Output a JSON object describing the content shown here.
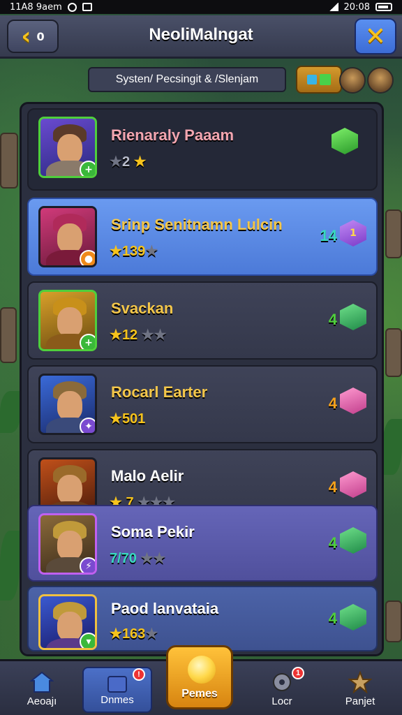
{
  "status_bar": {
    "time_left": "11A8 9aem",
    "time_right": "20:08"
  },
  "header": {
    "back_count": "0",
    "title": "NeoliMalngat"
  },
  "subbar": {
    "label": "Systen/ Pecsingit & /Slenjam"
  },
  "heroes": [
    {
      "name": "Rienaraly Paaam",
      "stars_prefix": "★",
      "level": "2",
      "stars_suffix": "★",
      "power": "",
      "gem_label": "",
      "gem_type": "green"
    },
    {
      "name": "Srinp Senitnamn Lulcin",
      "stars_prefix": "★",
      "level": "139",
      "stars_suffix": "★",
      "power": "14",
      "gem_label": "1",
      "gem_type": "purple"
    },
    {
      "name": "Svackan",
      "stars_prefix": "★",
      "level": "12",
      "stars_suffix": "★★",
      "power": "4",
      "gem_label": "",
      "gem_type": "green2"
    },
    {
      "name": "Rocarl Earter",
      "stars_prefix": "★",
      "level": "501",
      "stars_suffix": "",
      "power": "4",
      "gem_label": "",
      "gem_type": "pink"
    },
    {
      "name": "Malo Aelir",
      "stars_prefix": "★",
      "level": "7",
      "stars_suffix": "★★★",
      "power": "4",
      "gem_label": "",
      "gem_type": "pink"
    },
    {
      "name": "Soma Pekir",
      "stars_prefix": "",
      "level": "7/70",
      "stars_suffix": "★★",
      "power": "4",
      "gem_label": "",
      "gem_type": "green2"
    },
    {
      "name": "Paod lanvataia",
      "stars_prefix": "★",
      "level": "163",
      "stars_suffix": "★",
      "power": "4",
      "gem_label": "",
      "gem_type": "green2"
    }
  ],
  "bottom_nav": [
    {
      "label": "Aeoajı",
      "icon": "home-icon",
      "notif": ""
    },
    {
      "label": "Dnmes",
      "icon": "box-icon",
      "notif": "!"
    },
    {
      "label": "Pemes",
      "icon": "orb-icon",
      "notif": ""
    },
    {
      "label": "Locr",
      "icon": "gear-icon",
      "notif": "1"
    },
    {
      "label": "Panjet",
      "icon": "star-icon",
      "notif": ""
    }
  ],
  "colors": {
    "accent_gold": "#f6c31c",
    "selected_blue": "#5b8ee8",
    "panel_dark": "#2b2f3f"
  }
}
